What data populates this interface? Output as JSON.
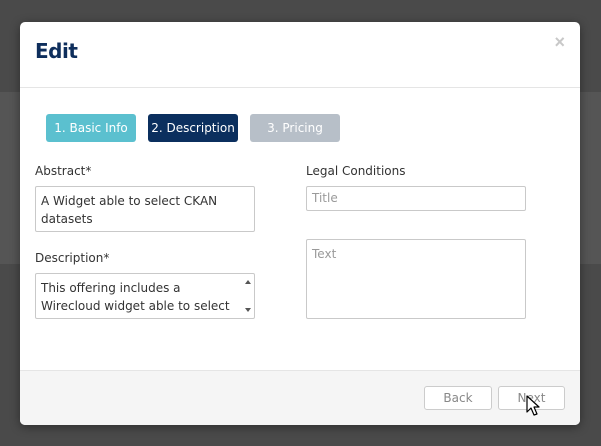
{
  "modal": {
    "title": "Edit",
    "close_symbol": "×"
  },
  "tabs": [
    {
      "label": "1. Basic Info"
    },
    {
      "label": "2. Description"
    },
    {
      "label": "3. Pricing"
    }
  ],
  "form": {
    "abstract_label": "Abstract*",
    "abstract_value": "A Widget able to select CKAN datasets",
    "description_label": "Description*",
    "description_value": "This offering includes a Wirecloud widget able to select",
    "legal_label": "Legal Conditions",
    "legal_title_placeholder": "Title",
    "legal_text_placeholder": "Text"
  },
  "footer": {
    "back_label": "Back",
    "next_label": "Next"
  },
  "colors": {
    "title": "#0e2e5c",
    "tab_basic": "#5bc0cf",
    "tab_description_active": "#0b2f5e",
    "tab_pricing_disabled": "#b7bfc8"
  }
}
